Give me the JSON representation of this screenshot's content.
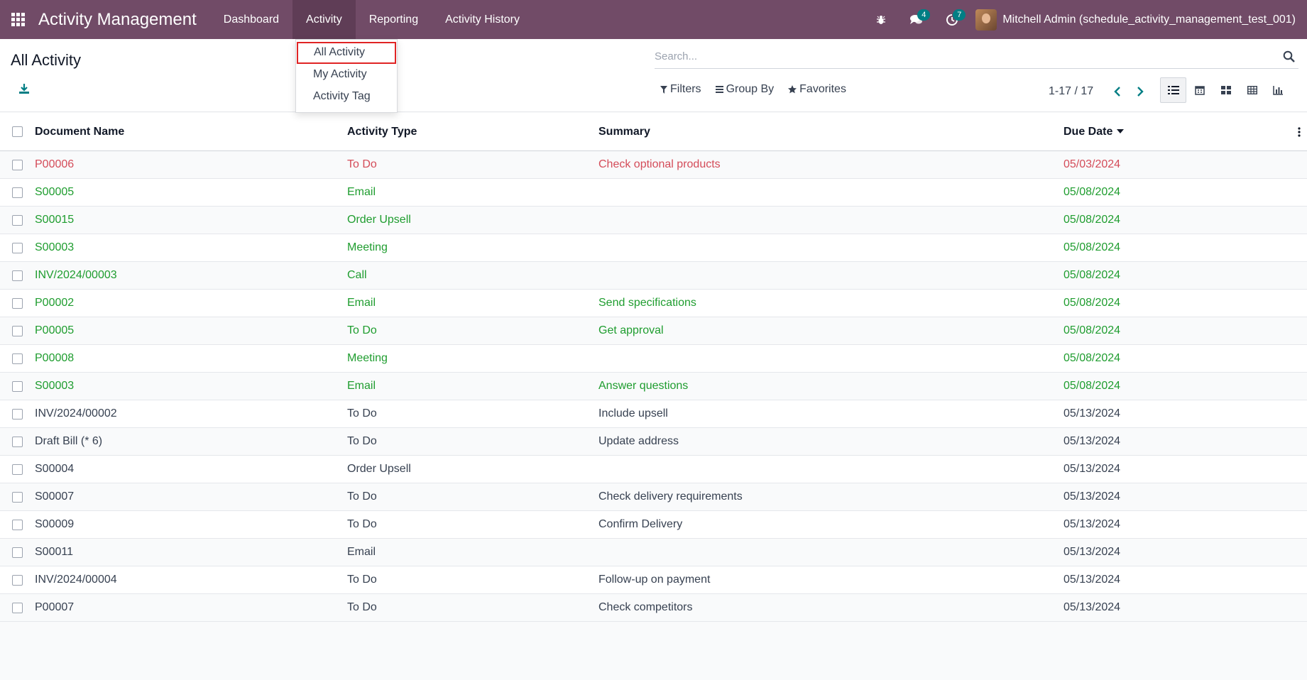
{
  "navbar": {
    "brand": "Activity Management",
    "menu": [
      {
        "label": "Dashboard"
      },
      {
        "label": "Activity"
      },
      {
        "label": "Reporting"
      },
      {
        "label": "Activity History"
      }
    ],
    "messages_count": "4",
    "activities_count": "7",
    "user_name": "Mitchell Admin (schedule_activity_management_test_001)"
  },
  "dropdown": {
    "items": [
      {
        "label": "All Activity"
      },
      {
        "label": "My Activity"
      },
      {
        "label": "Activity Tag"
      }
    ]
  },
  "control": {
    "title": "All Activity",
    "search_placeholder": "Search...",
    "filters_label": "Filters",
    "groupby_label": "Group By",
    "favorites_label": "Favorites",
    "pager": "1-17 / 17"
  },
  "table": {
    "headers": {
      "doc": "Document Name",
      "type": "Activity Type",
      "summary": "Summary",
      "due": "Due Date"
    },
    "rows": [
      {
        "doc": "P00006",
        "type": "To Do",
        "summary": "Check optional products",
        "due": "05/03/2024",
        "state": "overdue"
      },
      {
        "doc": "S00005",
        "type": "Email",
        "summary": "",
        "due": "05/08/2024",
        "state": "today"
      },
      {
        "doc": "S00015",
        "type": "Order Upsell",
        "summary": "",
        "due": "05/08/2024",
        "state": "today"
      },
      {
        "doc": "S00003",
        "type": "Meeting",
        "summary": "",
        "due": "05/08/2024",
        "state": "today"
      },
      {
        "doc": "INV/2024/00003",
        "type": "Call",
        "summary": "",
        "due": "05/08/2024",
        "state": "today"
      },
      {
        "doc": "P00002",
        "type": "Email",
        "summary": "Send specifications",
        "due": "05/08/2024",
        "state": "today"
      },
      {
        "doc": "P00005",
        "type": "To Do",
        "summary": "Get approval",
        "due": "05/08/2024",
        "state": "today"
      },
      {
        "doc": "P00008",
        "type": "Meeting",
        "summary": "",
        "due": "05/08/2024",
        "state": "today"
      },
      {
        "doc": "S00003",
        "type": "Email",
        "summary": "Answer questions",
        "due": "05/08/2024",
        "state": "today"
      },
      {
        "doc": "INV/2024/00002",
        "type": "To Do",
        "summary": "Include upsell",
        "due": "05/13/2024",
        "state": "planned"
      },
      {
        "doc": "Draft Bill (* 6)",
        "type": "To Do",
        "summary": "Update address",
        "due": "05/13/2024",
        "state": "planned"
      },
      {
        "doc": "S00004",
        "type": "Order Upsell",
        "summary": "",
        "due": "05/13/2024",
        "state": "planned"
      },
      {
        "doc": "S00007",
        "type": "To Do",
        "summary": "Check delivery requirements",
        "due": "05/13/2024",
        "state": "planned"
      },
      {
        "doc": "S00009",
        "type": "To Do",
        "summary": "Confirm Delivery",
        "due": "05/13/2024",
        "state": "planned"
      },
      {
        "doc": "S00011",
        "type": "Email",
        "summary": "",
        "due": "05/13/2024",
        "state": "planned"
      },
      {
        "doc": "INV/2024/00004",
        "type": "To Do",
        "summary": "Follow-up on payment",
        "due": "05/13/2024",
        "state": "planned"
      },
      {
        "doc": "P00007",
        "type": "To Do",
        "summary": "Check competitors",
        "due": "05/13/2024",
        "state": "planned"
      }
    ]
  }
}
